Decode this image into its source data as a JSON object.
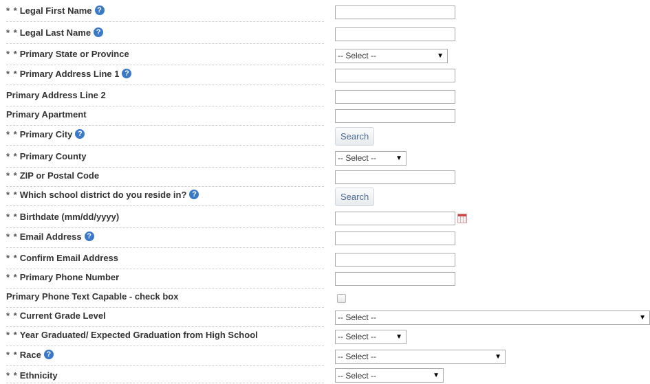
{
  "required_marker": "* *",
  "help_glyph": "?",
  "fields": {
    "legal_first_name": {
      "label": "Legal First Name",
      "value": ""
    },
    "legal_last_name": {
      "label": "Legal Last Name",
      "value": ""
    },
    "primary_state": {
      "label": "Primary State or Province",
      "selected": "-- Select --"
    },
    "address_line_1": {
      "label": "Primary Address Line 1",
      "value": ""
    },
    "address_line_2": {
      "label": "Primary Address Line 2",
      "value": ""
    },
    "apartment": {
      "label": "Primary Apartment",
      "value": ""
    },
    "city": {
      "label": "Primary City",
      "button": "Search"
    },
    "county": {
      "label": "Primary County",
      "selected": "-- Select --"
    },
    "zip": {
      "label": "ZIP or Postal Code",
      "value": ""
    },
    "school_district": {
      "label": "Which school district do you reside in?",
      "button": "Search"
    },
    "birthdate": {
      "label": "Birthdate (mm/dd/yyyy)",
      "value": ""
    },
    "email": {
      "label": "Email Address",
      "value": ""
    },
    "confirm_email": {
      "label": "Confirm Email Address",
      "value": ""
    },
    "phone": {
      "label": "Primary Phone Number",
      "value": ""
    },
    "text_capable": {
      "label": "Primary Phone Text Capable - check box",
      "checked": false
    },
    "grade_level": {
      "label": "Current Grade Level",
      "selected": "-- Select --"
    },
    "year_graduated": {
      "label": "Year Graduated/ Expected Graduation from High School",
      "selected": "-- Select --"
    },
    "race": {
      "label": "Race",
      "selected": "-- Select --"
    },
    "ethnicity": {
      "label": "Ethnicity",
      "selected": "-- Select --"
    }
  },
  "icons": {
    "help": "help-icon",
    "calendar": "calendar-icon",
    "caret": "caret-down-icon"
  },
  "colors": {
    "help_icon": "#3a79c9",
    "button_text": "#4b6d98",
    "divider": "#cfcfcf"
  }
}
